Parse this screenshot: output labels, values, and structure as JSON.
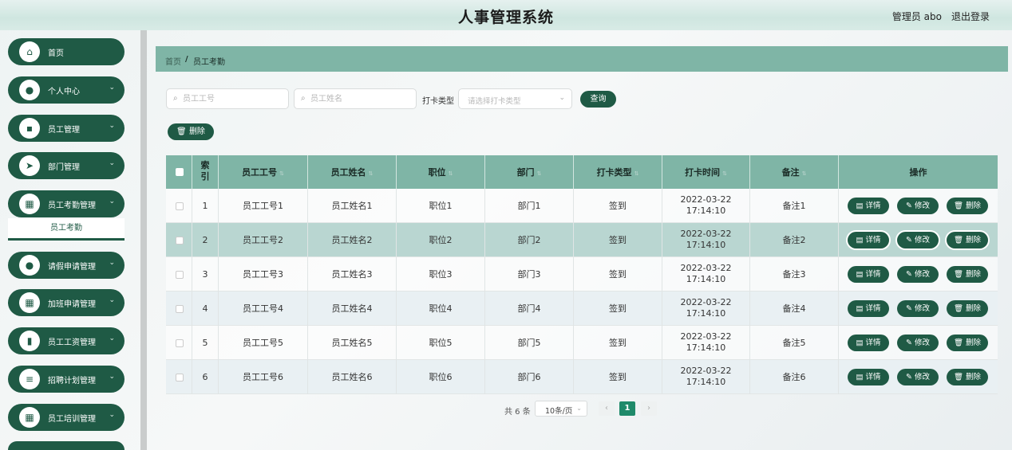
{
  "header": {
    "title": "人事管理系统",
    "user": "管理员 abo",
    "logout": "退出登录"
  },
  "sidebar": {
    "items": [
      {
        "label": "首页",
        "icon": "⌂",
        "chev": ""
      },
      {
        "label": "个人中心",
        "icon": "●",
        "chev": "⌄"
      },
      {
        "label": "员工管理",
        "icon": "▪",
        "chev": "⌄"
      },
      {
        "label": "部门管理",
        "icon": "➤",
        "chev": "⌄"
      },
      {
        "label": "员工考勤管理",
        "icon": "▦",
        "chev": "⌄"
      },
      {
        "label": "请假申请管理",
        "icon": "●",
        "chev": "⌄"
      },
      {
        "label": "加班申请管理",
        "icon": "▦",
        "chev": "⌄"
      },
      {
        "label": "员工工资管理",
        "icon": "▮",
        "chev": "⌄"
      },
      {
        "label": "招聘计划管理",
        "icon": "≡",
        "chev": "⌄"
      },
      {
        "label": "员工培训管理",
        "icon": "▦",
        "chev": "⌄"
      }
    ],
    "submenu": "员工考勤"
  },
  "breadcrumb": {
    "home": "首页",
    "sep": "/",
    "current": "员工考勤"
  },
  "search": {
    "emp_no_placeholder": "员工工号",
    "emp_name_placeholder": "员工姓名",
    "type_label": "打卡类型",
    "type_placeholder": "请选择打卡类型",
    "query": "查询"
  },
  "delete_btn": "删除",
  "table": {
    "headers": {
      "index": "索引",
      "emp_no": "员工工号",
      "emp_name": "员工姓名",
      "position": "职位",
      "department": "部门",
      "punch_type": "打卡类型",
      "punch_time": "打卡时间",
      "note": "备注",
      "actions": "操作"
    },
    "rows": [
      {
        "index": "1",
        "emp_no": "员工工号1",
        "emp_name": "员工姓名1",
        "position": "职位1",
        "department": "部门1",
        "punch_type": "签到",
        "punch_time": "2022-03-22 17:14:10",
        "note": "备注1"
      },
      {
        "index": "2",
        "emp_no": "员工工号2",
        "emp_name": "员工姓名2",
        "position": "职位2",
        "department": "部门2",
        "punch_type": "签到",
        "punch_time": "2022-03-22 17:14:10",
        "note": "备注2"
      },
      {
        "index": "3",
        "emp_no": "员工工号3",
        "emp_name": "员工姓名3",
        "position": "职位3",
        "department": "部门3",
        "punch_type": "签到",
        "punch_time": "2022-03-22 17:14:10",
        "note": "备注3"
      },
      {
        "index": "4",
        "emp_no": "员工工号4",
        "emp_name": "员工姓名4",
        "position": "职位4",
        "department": "部门4",
        "punch_type": "签到",
        "punch_time": "2022-03-22 17:14:10",
        "note": "备注4"
      },
      {
        "index": "5",
        "emp_no": "员工工号5",
        "emp_name": "员工姓名5",
        "position": "职位5",
        "department": "部门5",
        "punch_type": "签到",
        "punch_time": "2022-03-22 17:14:10",
        "note": "备注5"
      },
      {
        "index": "6",
        "emp_no": "员工工号6",
        "emp_name": "员工姓名6",
        "position": "职位6",
        "department": "部门6",
        "punch_type": "签到",
        "punch_time": "2022-03-22 17:14:10",
        "note": "备注6"
      }
    ],
    "actions": {
      "detail": "详情",
      "edit": "修改",
      "delete": "删除"
    }
  },
  "pagination": {
    "total": "共 6 条",
    "page_size": "10条/页",
    "current": "1",
    "prev": "‹",
    "next": "›"
  },
  "colors": {
    "primary": "#1f5a45",
    "header_bg": "#7fb5a6",
    "page_active": "#1f8a6a"
  }
}
